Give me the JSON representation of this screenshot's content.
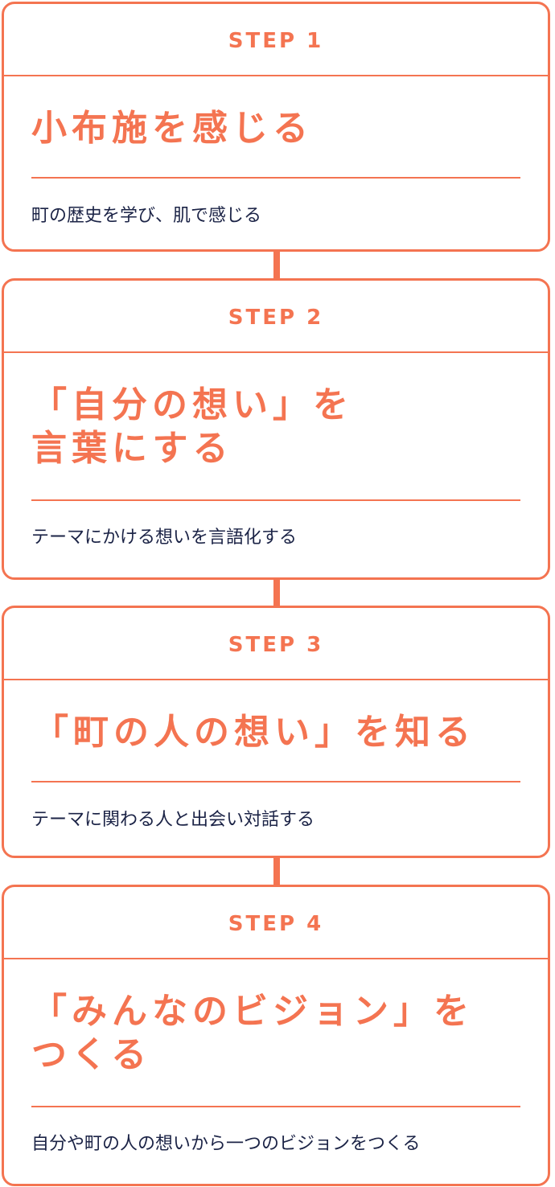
{
  "theme": {
    "accent": "#F47451",
    "text": "#1B2346",
    "background": "#ffffff"
  },
  "steps": [
    {
      "label": "STEP 1",
      "title": "小布施を感じる",
      "description": "町の歴史を学び、肌で感じる"
    },
    {
      "label": "STEP 2",
      "title": "「自分の想い」を\n言葉にする",
      "description": "テーマにかける想いを言語化する"
    },
    {
      "label": "STEP 3",
      "title": "「町の人の想い」を知る",
      "description": "テーマに関わる人と出会い対話する"
    },
    {
      "label": "STEP 4",
      "title": "「みんなのビジョン」を\nつくる",
      "description": "自分や町の人の想いから一つのビジョンをつくる"
    }
  ]
}
